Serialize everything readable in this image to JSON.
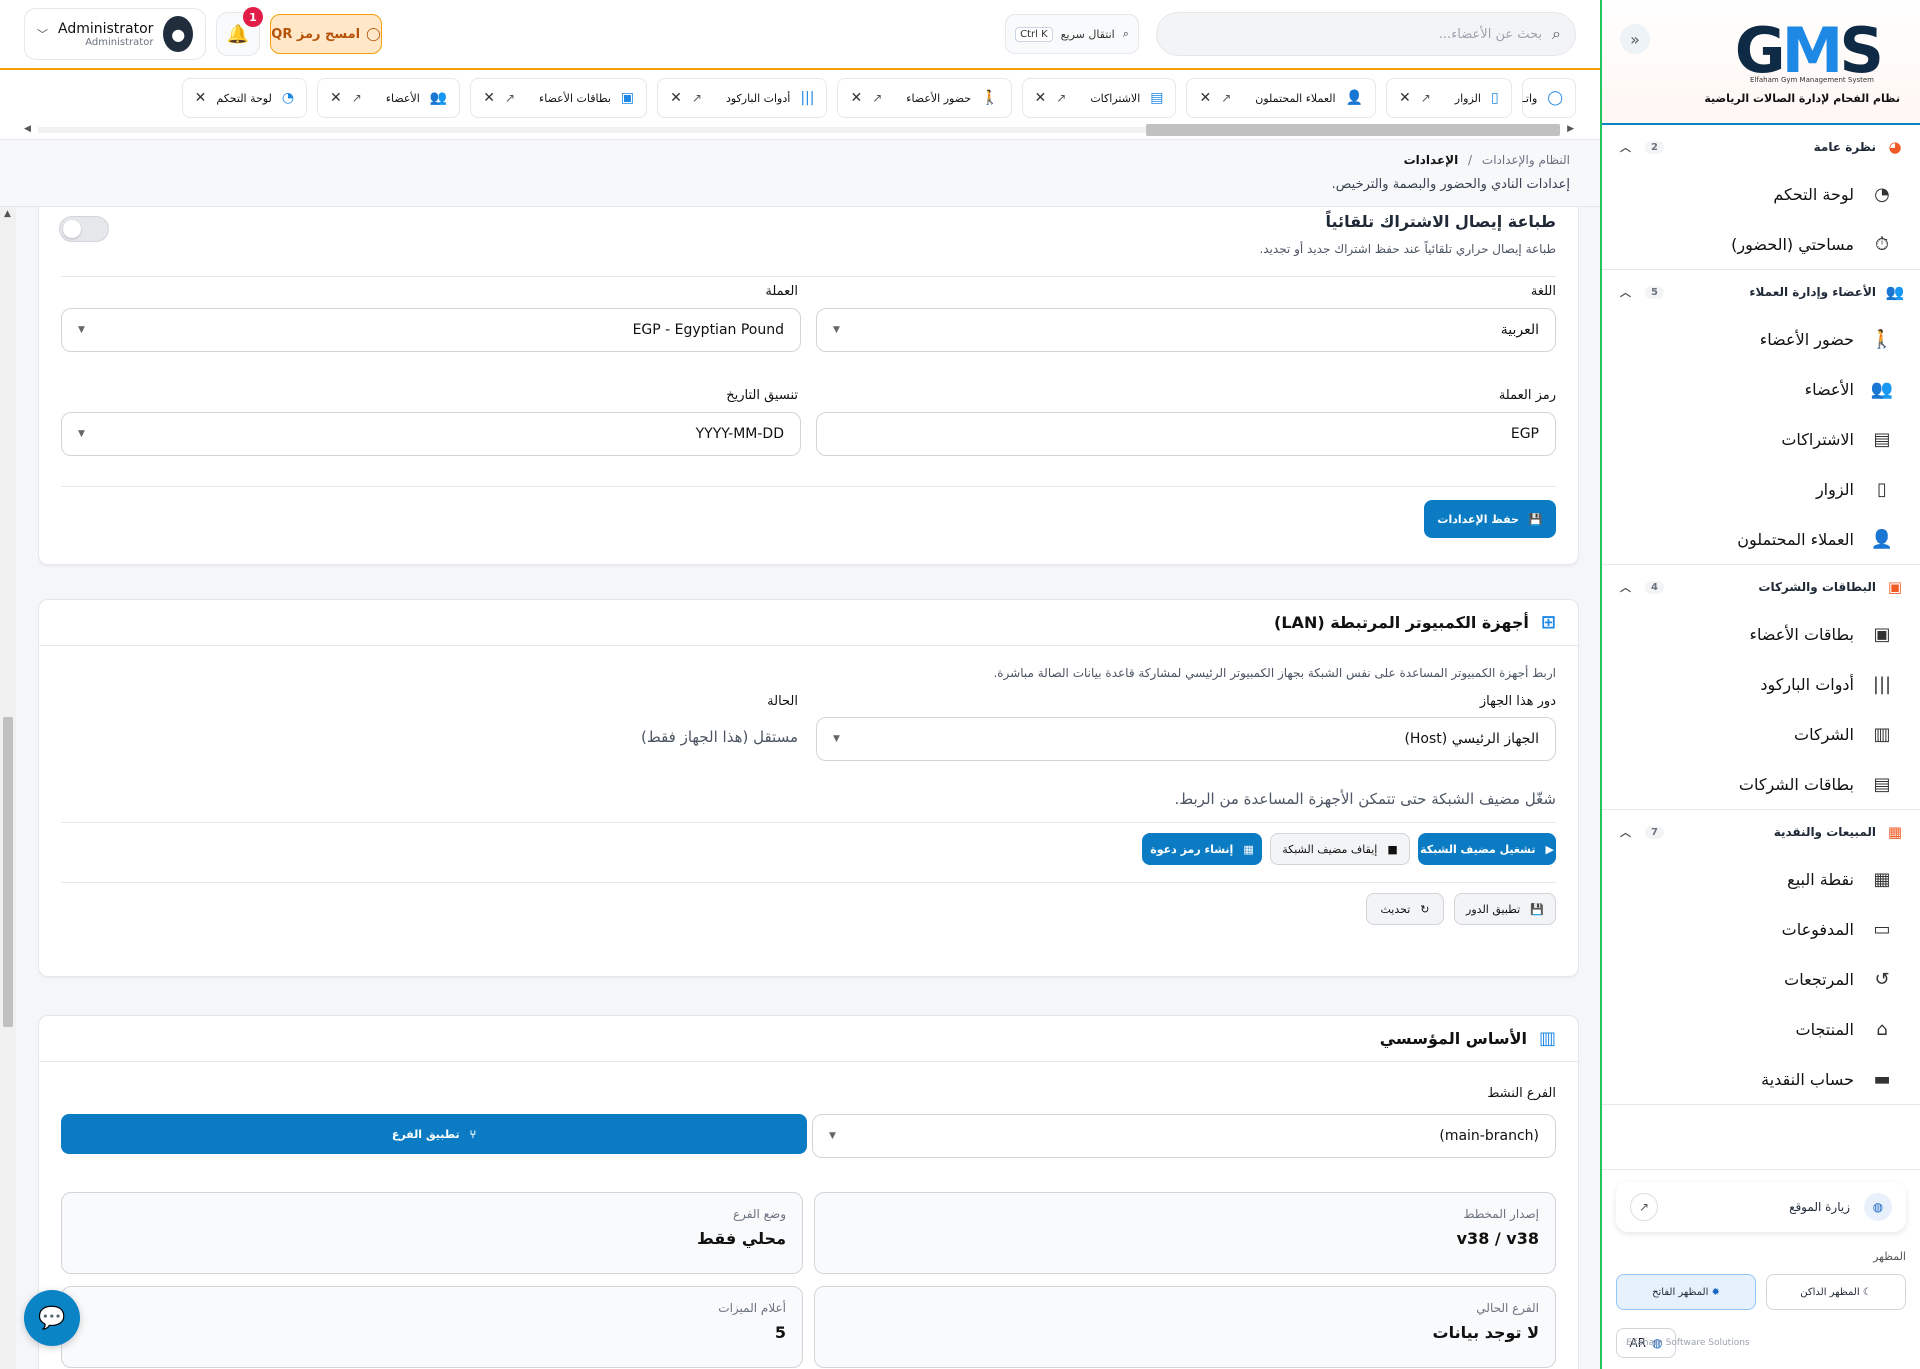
{
  "sidebar": {
    "logo": "GMS",
    "logo_sub": "Elfaham Gym Management System",
    "tagline": "نظام الفحام لإدارة الصالات الرياضية",
    "groups": [
      {
        "title": "نظرة عامة",
        "count": "2",
        "icon": "gauge-icon",
        "items": [
          {
            "label": "لوحة التحكم",
            "icon": "dashboard-icon"
          },
          {
            "label": "مساحتي (الحضور)",
            "icon": "stopwatch-icon"
          }
        ]
      },
      {
        "title": "الأعضاء وإدارة العملاء",
        "count": "5",
        "icon": "users-icon",
        "items": [
          {
            "label": "حضور الأعضاء",
            "icon": "walking-icon"
          },
          {
            "label": "الأعضاء",
            "icon": "users-icon"
          },
          {
            "label": "الاشتراكات",
            "icon": "id-card-icon"
          },
          {
            "label": "الزوار",
            "icon": "door-icon"
          },
          {
            "label": "العملاء المحتملون",
            "icon": "user-plus-icon"
          }
        ]
      },
      {
        "title": "البطاقات والشركات",
        "count": "4",
        "icon": "id-card-icon",
        "items": [
          {
            "label": "بطاقات الأعضاء",
            "icon": "badge-icon"
          },
          {
            "label": "أدوات الباركود",
            "icon": "barcode-icon"
          },
          {
            "label": "الشركات",
            "icon": "building-icon"
          },
          {
            "label": "بطاقات الشركات",
            "icon": "card-icon"
          }
        ]
      },
      {
        "title": "المبيعات والنقدية",
        "count": "7",
        "icon": "cash-register-icon",
        "items": [
          {
            "label": "نقطة البيع",
            "icon": "cash-register-icon"
          },
          {
            "label": "المدفوعات",
            "icon": "money-icon"
          },
          {
            "label": "المرتجعات",
            "icon": "undo-icon"
          },
          {
            "label": "المنتجات",
            "icon": "basket-icon"
          },
          {
            "label": "حساب النقدية",
            "icon": "wallet-icon"
          }
        ]
      }
    ],
    "visit_site": "زيارة الموقع",
    "appearance_label": "المظهر",
    "dark_theme": "المظهر الداكن",
    "light_theme": "المظهر الفاتح",
    "language": "AR",
    "company": "Elfaham Software Solutions"
  },
  "topbar": {
    "search_placeholder": "بحث عن الأعضاء...",
    "quick_jump": "انتقال سريع",
    "quick_kbd": "Ctrl K",
    "qr_button": "امسح رمز QR",
    "notif_count": "1",
    "user_name": "Administrator",
    "user_role": "Administrator"
  },
  "tabs": [
    {
      "label": "لوحة التحكم",
      "icon": "dashboard-icon"
    },
    {
      "label": "الأعضاء",
      "icon": "users-icon"
    },
    {
      "label": "بطاقات الأعضاء",
      "icon": "badge-icon"
    },
    {
      "label": "أدوات الباركود",
      "icon": "barcode-icon"
    },
    {
      "label": "حضور الأعضاء",
      "icon": "walking-icon"
    },
    {
      "label": "الاشتراكات",
      "icon": "id-card-icon"
    },
    {
      "label": "العملاء المحتملون",
      "icon": "user-plus-icon"
    },
    {
      "label": "الزوار",
      "icon": "door-icon"
    },
    {
      "label": "واتـ",
      "icon": "whatsapp-icon"
    }
  ],
  "breadcrumb": {
    "parent": "النظام والإعدادات",
    "sep": "/",
    "current": "الإعدادات",
    "description": "إعدادات النادي والحضور والبصمة والترخيص."
  },
  "general_card": {
    "auto_print_title": "طباعة إيصال الاشتراك تلقائياً",
    "auto_print_desc": "طباعة إيصال حراري تلقائياً عند حفظ اشتراك جديد أو تجديد.",
    "language_label": "اللغة",
    "language_value": "العربية",
    "currency_label": "العملة",
    "currency_value": "EGP - Egyptian Pound",
    "currency_symbol_label": "رمز العملة",
    "currency_symbol_value": "EGP",
    "date_format_label": "تنسيق التاريخ",
    "date_format_value": "YYYY-MM-DD",
    "save_button": "حفظ الإعدادات"
  },
  "lan_card": {
    "title": "أجهزة الكمبيوتر المرتبطة (LAN)",
    "description": "اربط أجهزة الكمبيوتر المساعدة على نفس الشبكة بجهاز الكمبيوتر الرئيسي لمشاركة قاعدة بيانات الصالة مباشرة.",
    "role_label": "دور هذا الجهاز",
    "role_value": "الجهاز الرئيسي (Host)",
    "status_label": "الحالة",
    "status_value": "مستقل (هذا الجهاز فقط)",
    "hint": "شغّل مضيف الشبكة حتى تتمكن الأجهزة المساعدة من الربط.",
    "start_host": "تشغيل مضيف الشبكة",
    "stop_host": "إيقاف مضيف الشبكة",
    "create_invite": "إنشاء رمز دعوة",
    "apply_role": "تطبيق الدور",
    "refresh": "تحديث"
  },
  "branch_card": {
    "title": "الأساس المؤسسي",
    "active_branch_label": "الفرع النشط",
    "active_branch_value": "(main-branch)",
    "apply_branch": "تطبيق الفرع",
    "schema_label": "إصدار المخطط",
    "schema_value": "v38 / v38",
    "branch_mode_label": "وضع الفرع",
    "branch_mode_value": "محلي فقط",
    "current_branch_label": "الفرع الحالي",
    "current_branch_value": "لا توجد بيانات",
    "feature_flags_label": "أعلام الميزات",
    "feature_flags_value": "5"
  },
  "colors": {
    "primary": "#0b7cc4",
    "accent": "#f15a24",
    "sidebar_border": "#22c55e"
  }
}
